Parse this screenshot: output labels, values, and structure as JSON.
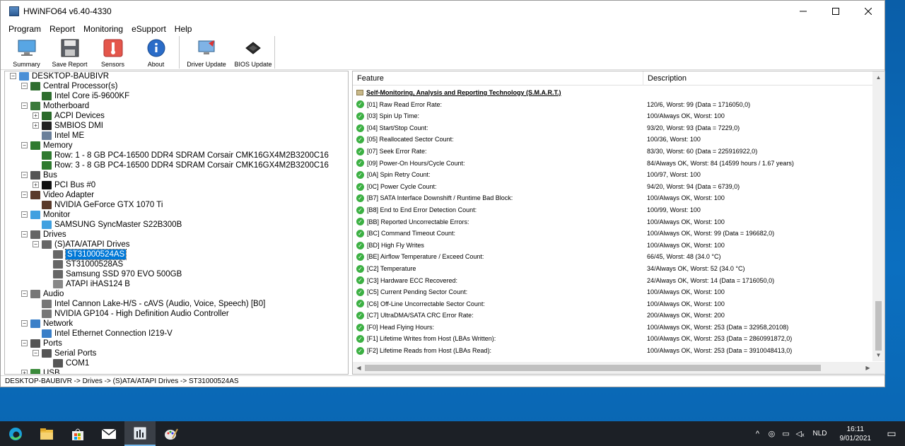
{
  "window": {
    "title": "HWiNFO64 v6.40-4330",
    "minimize_icon": "minimize-icon",
    "maximize_icon": "maximize-icon",
    "close_icon": "close-icon"
  },
  "menu": [
    "Program",
    "Report",
    "Monitoring",
    "eSupport",
    "Help"
  ],
  "toolbar": {
    "summary": "Summary",
    "save_report": "Save Report",
    "sensors": "Sensors",
    "about": "About",
    "driver_update": "Driver Update",
    "bios_update": "BIOS Update"
  },
  "tree": [
    {
      "label": "DESKTOP-BAUBIVR",
      "icon": "computer-icon",
      "level": 0,
      "exp": "-"
    },
    {
      "label": "Central Processor(s)",
      "icon": "cpu-icon",
      "level": 1,
      "exp": "-"
    },
    {
      "label": "Intel Core i5-9600KF",
      "icon": "cpu-icon",
      "level": 2,
      "exp": ""
    },
    {
      "label": "Motherboard",
      "icon": "motherboard-icon",
      "level": 1,
      "exp": "-"
    },
    {
      "label": "ACPI Devices",
      "icon": "acpi-icon",
      "level": 2,
      "exp": "+"
    },
    {
      "label": "SMBIOS DMI",
      "icon": "dmi-icon",
      "level": 2,
      "exp": "+"
    },
    {
      "label": "Intel ME",
      "icon": "gear-icon",
      "level": 2,
      "exp": ""
    },
    {
      "label": "Memory",
      "icon": "memory-icon",
      "level": 1,
      "exp": "-"
    },
    {
      "label": "Row: 1 - 8 GB PC4-16500 DDR4 SDRAM Corsair CMK16GX4M2B3200C16",
      "icon": "memory-icon",
      "level": 2,
      "exp": ""
    },
    {
      "label": "Row: 3 - 8 GB PC4-16500 DDR4 SDRAM Corsair CMK16GX4M2B3200C16",
      "icon": "memory-icon",
      "level": 2,
      "exp": ""
    },
    {
      "label": "Bus",
      "icon": "bus-icon",
      "level": 1,
      "exp": "-"
    },
    {
      "label": "PCI Bus #0",
      "icon": "pci-icon",
      "level": 2,
      "exp": "+"
    },
    {
      "label": "Video Adapter",
      "icon": "gpu-icon",
      "level": 1,
      "exp": "-"
    },
    {
      "label": "NVIDIA GeForce GTX 1070 Ti",
      "icon": "gpu-icon",
      "level": 2,
      "exp": ""
    },
    {
      "label": "Monitor",
      "icon": "monitor-icon",
      "level": 1,
      "exp": "-"
    },
    {
      "label": "SAMSUNG SyncMaster S22B300B",
      "icon": "monitor-icon",
      "level": 2,
      "exp": ""
    },
    {
      "label": "Drives",
      "icon": "drive-icon",
      "level": 1,
      "exp": "-"
    },
    {
      "label": "(S)ATA/ATAPI Drives",
      "icon": "drive-icon",
      "level": 2,
      "exp": "-"
    },
    {
      "label": "ST31000524AS",
      "icon": "drive-icon",
      "level": 3,
      "exp": "",
      "selected": true
    },
    {
      "label": "ST31000528AS",
      "icon": "drive-icon",
      "level": 3,
      "exp": ""
    },
    {
      "label": "Samsung SSD 970 EVO 500GB",
      "icon": "drive-icon",
      "level": 3,
      "exp": ""
    },
    {
      "label": "ATAPI iHAS124   B",
      "icon": "optical-drive-icon",
      "level": 3,
      "exp": ""
    },
    {
      "label": "Audio",
      "icon": "speaker-icon",
      "level": 1,
      "exp": "-"
    },
    {
      "label": "Intel Cannon Lake-H/S - cAVS (Audio, Voice, Speech) [B0]",
      "icon": "speaker-icon",
      "level": 2,
      "exp": ""
    },
    {
      "label": "NVIDIA GP104 - High Definition Audio Controller",
      "icon": "speaker-icon",
      "level": 2,
      "exp": ""
    },
    {
      "label": "Network",
      "icon": "network-icon",
      "level": 1,
      "exp": "-"
    },
    {
      "label": "Intel Ethernet Connection I219-V",
      "icon": "network-icon",
      "level": 2,
      "exp": ""
    },
    {
      "label": "Ports",
      "icon": "port-icon",
      "level": 1,
      "exp": "-"
    },
    {
      "label": "Serial Ports",
      "icon": "port-icon",
      "level": 2,
      "exp": "-"
    },
    {
      "label": "COM1",
      "icon": "port-icon",
      "level": 3,
      "exp": ""
    },
    {
      "label": "USB",
      "icon": "usb-icon",
      "level": 1,
      "exp": "+"
    }
  ],
  "columns": {
    "feature": "Feature",
    "description": "Description"
  },
  "section_title": "Self-Monitoring, Analysis and Reporting Technology (S.M.A.R.T.)",
  "rows": [
    {
      "feature": "[01] Raw Read Error Rate:",
      "desc": "120/6, Worst: 99 (Data = 1716050,0)"
    },
    {
      "feature": "[03] Spin Up Time:",
      "desc": "100/Always OK, Worst: 100"
    },
    {
      "feature": "[04] Start/Stop Count:",
      "desc": "93/20, Worst: 93 (Data = 7229,0)"
    },
    {
      "feature": "[05] Reallocated Sector Count:",
      "desc": "100/36, Worst: 100"
    },
    {
      "feature": "[07] Seek Error Rate:",
      "desc": "83/30, Worst: 60 (Data = 225916922,0)"
    },
    {
      "feature": "[09] Power-On Hours/Cycle Count:",
      "desc": "84/Always OK, Worst: 84 (14599 hours / 1.67 years)"
    },
    {
      "feature": "[0A] Spin Retry Count:",
      "desc": "100/97, Worst: 100"
    },
    {
      "feature": "[0C] Power Cycle Count:",
      "desc": "94/20, Worst: 94 (Data = 6739,0)"
    },
    {
      "feature": "[B7] SATA Interface Downshift / Runtime Bad Block:",
      "desc": "100/Always OK, Worst: 100"
    },
    {
      "feature": "[B8] End to End Error Detection Count:",
      "desc": "100/99, Worst: 100"
    },
    {
      "feature": "[BB] Reported Uncorrectable Errors:",
      "desc": "100/Always OK, Worst: 100"
    },
    {
      "feature": "[BC] Command Timeout Count:",
      "desc": "100/Always OK, Worst: 99 (Data = 196682,0)"
    },
    {
      "feature": "[BD] High Fly Writes",
      "desc": "100/Always OK, Worst: 100"
    },
    {
      "feature": "[BE] Airflow Temperature / Exceed Count:",
      "desc": "66/45, Worst: 48 (34.0 °C)"
    },
    {
      "feature": "[C2] Temperature",
      "desc": "34/Always OK, Worst: 52 (34.0 °C)"
    },
    {
      "feature": "[C3] Hardware ECC Recovered:",
      "desc": "24/Always OK, Worst: 14 (Data = 1716050,0)"
    },
    {
      "feature": "[C5] Current Pending Sector Count:",
      "desc": "100/Always OK, Worst: 100"
    },
    {
      "feature": "[C6] Off-Line Uncorrectable Sector Count:",
      "desc": "100/Always OK, Worst: 100"
    },
    {
      "feature": "[C7] UltraDMA/SATA CRC Error Rate:",
      "desc": "200/Always OK, Worst: 200"
    },
    {
      "feature": "[F0] Head Flying Hours:",
      "desc": "100/Always OK, Worst: 253 (Data = 32958,20108)"
    },
    {
      "feature": "[F1] Lifetime Writes from Host (LBAs Written):",
      "desc": "100/Always OK, Worst: 253 (Data = 2860991872,0)"
    },
    {
      "feature": "[F2] Lifetime Reads from Host (LBAs Read):",
      "desc": "100/Always OK, Worst: 253 (Data = 3910048413,0)"
    }
  ],
  "statusbar": "DESKTOP-BAUBIVR -> Drives -> (S)ATA/ATAPI Drives -> ST31000524AS",
  "taskbar": {
    "items": [
      "edge-icon",
      "file-explorer-icon",
      "store-icon",
      "mail-icon",
      "hwinfo-icon",
      "paint-icon"
    ],
    "lang": "NLD",
    "time": "16:11",
    "date": "9/01/2021"
  }
}
